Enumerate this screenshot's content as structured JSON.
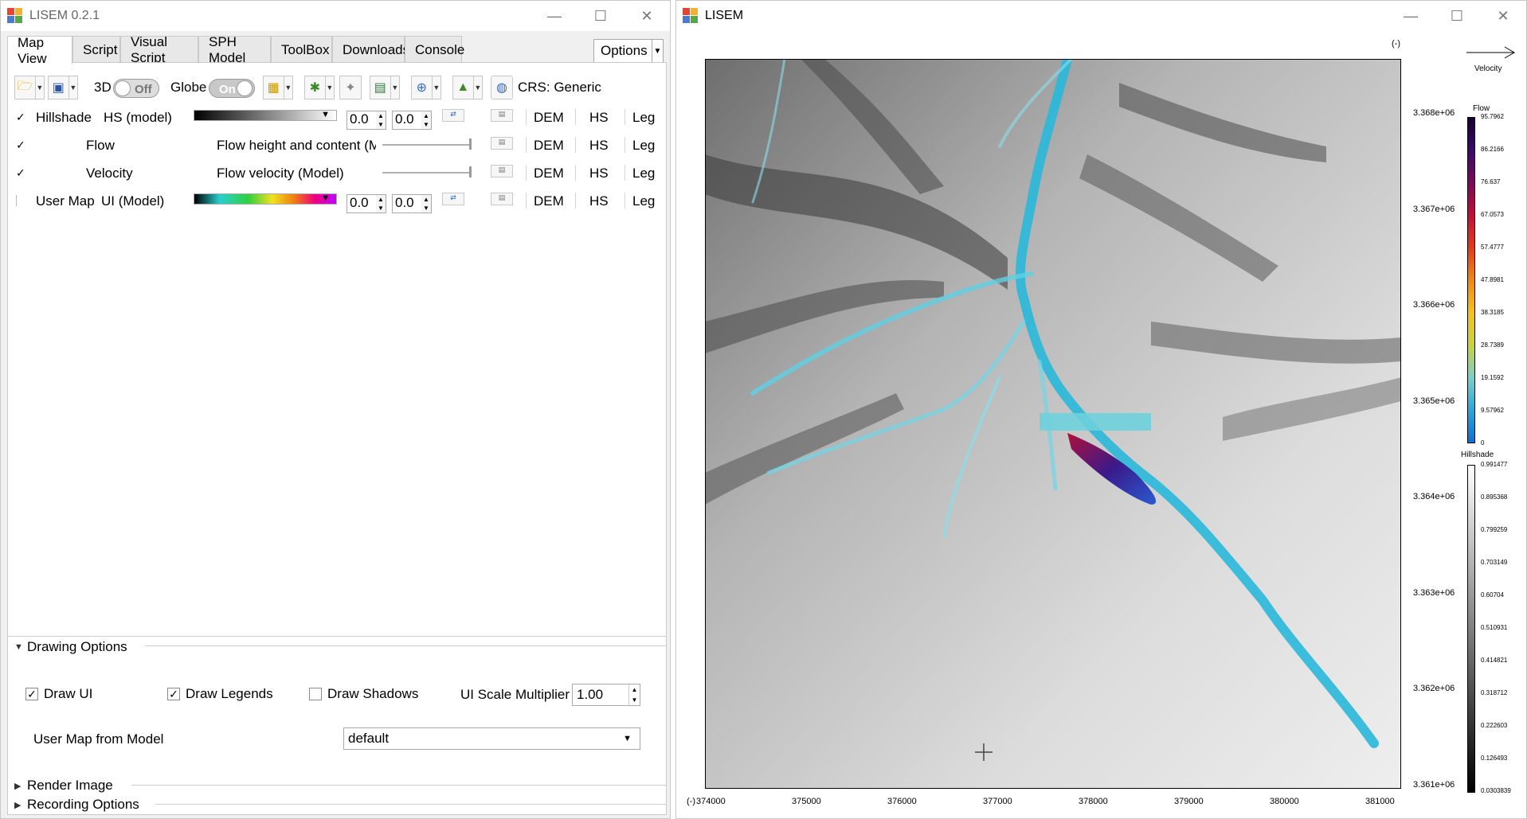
{
  "left_window": {
    "title": "LISEM 0.2.1",
    "controls": {
      "minimize": "—",
      "maximize": "☐",
      "close": "✕"
    },
    "tabs": [
      "Map View",
      "Script",
      "Visual Script",
      "SPH Model",
      "ToolBox",
      "Downloads",
      "Console"
    ],
    "options_label": "Options",
    "toolbar": {
      "label_3d": "3D",
      "toggle_3d": "Off",
      "label_globe": "Globe",
      "toggle_globe": "On",
      "crs_label": "CRS: Generic"
    },
    "layers": [
      {
        "checked": "✓",
        "name": "Hillshade",
        "source": "HS (model)",
        "min": "0.0",
        "max": "0.0",
        "dem": "DEM",
        "hs": "HS",
        "leg": "Leg"
      },
      {
        "checked": "✓",
        "name": "Flow",
        "source": "Flow height and content (M",
        "dem": "DEM",
        "hs": "HS",
        "leg": "Leg"
      },
      {
        "checked": "✓",
        "name": "Velocity",
        "source": "Flow velocity (Model)",
        "dem": "DEM",
        "hs": "HS",
        "leg": "Leg"
      },
      {
        "checked": "",
        "name": "User Map",
        "source": "UI (Model)",
        "min": "0.0",
        "max": "0.0",
        "dem": "DEM",
        "hs": "HS",
        "leg": "Leg"
      }
    ],
    "drawing_options": {
      "title": "Drawing Options",
      "draw_ui": "Draw UI",
      "draw_legends": "Draw Legends",
      "draw_shadows": "Draw Shadows",
      "ui_scale_label": "UI Scale Multiplier",
      "ui_scale_value": "1.00",
      "user_map_label": "User Map from Model",
      "user_map_value": "default"
    },
    "render_image": "Render Image",
    "recording_options": "Recording Options"
  },
  "right_window": {
    "title": "LISEM",
    "controls": {
      "minimize": "—",
      "maximize": "☐",
      "close": "✕"
    },
    "corner_unit_top": "(-)",
    "corner_unit_bottom": "(-)",
    "x_ticks": [
      "374000",
      "375000",
      "376000",
      "377000",
      "378000",
      "379000",
      "380000",
      "381000"
    ],
    "y_ticks": [
      "3.368e+06",
      "3.367e+06",
      "3.366e+06",
      "3.365e+06",
      "3.364e+06",
      "3.363e+06",
      "3.362e+06",
      "3.361e+06"
    ],
    "velocity_legend": "Velocity",
    "flow_legend": {
      "title": "Flow",
      "ticks": [
        "95.7962",
        "86.2166",
        "76.637",
        "67.0573",
        "57.4777",
        "47.8981",
        "38.3185",
        "28.7389",
        "19.1592",
        "9.57962",
        "0"
      ],
      "colors": [
        "#1a0033",
        "#3a0b6b",
        "#7a0a5a",
        "#c0103a",
        "#e43b1b",
        "#f08a10",
        "#f4c21a",
        "#c9d43a",
        "#7bcfc8",
        "#2aa9d9",
        "#0f6fd0"
      ]
    },
    "hillshade_legend": {
      "title": "Hillshade",
      "ticks": [
        "0.991477",
        "0.895368",
        "0.799259",
        "0.703149",
        "0.60704",
        "0.510931",
        "0.414821",
        "0.318712",
        "0.222603",
        "0.126493",
        "0.0303839"
      ]
    }
  }
}
